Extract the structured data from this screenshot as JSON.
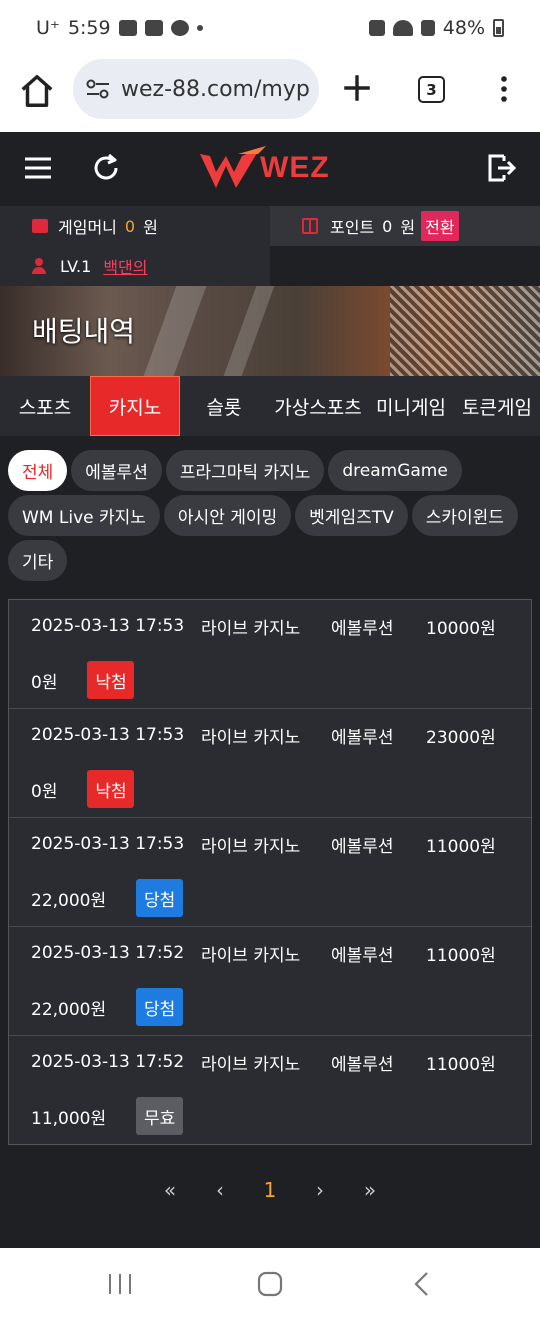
{
  "status": {
    "carrier": "U⁺",
    "time": "5:59",
    "battery": "48%"
  },
  "browser": {
    "url": "wez-88.com/myp",
    "tab_count": "3"
  },
  "site": {
    "logo_text": "WEZ",
    "money_label": "게임머니",
    "money_value": "0",
    "money_unit": "원",
    "point_label": "포인트",
    "point_value": "0",
    "point_unit": "원",
    "convert": "전환",
    "level": "LV.1",
    "nickname": "백댄의"
  },
  "banner": {
    "title": "배팅내역"
  },
  "tabs": [
    "스포츠",
    "카지노",
    "슬롯",
    "가상스포츠",
    "미니게임",
    "토큰게임"
  ],
  "chips": [
    "전체",
    "에볼루션",
    "프라그마틱 카지노",
    "dreamGame",
    "WM Live 카지노",
    "아시안 게이밍",
    "벳게임즈TV",
    "스카이윈드",
    "기타"
  ],
  "bets": [
    {
      "date": "2025-03-13 17:53",
      "type": "라이브 카지노",
      "game": "에볼루션",
      "amount": "10000원",
      "payout": "0원",
      "result": "낙첨",
      "status": "lose"
    },
    {
      "date": "2025-03-13 17:53",
      "type": "라이브 카지노",
      "game": "에볼루션",
      "amount": "23000원",
      "payout": "0원",
      "result": "낙첨",
      "status": "lose"
    },
    {
      "date": "2025-03-13 17:53",
      "type": "라이브 카지노",
      "game": "에볼루션",
      "amount": "11000원",
      "payout": "22,000원",
      "result": "당첨",
      "status": "win"
    },
    {
      "date": "2025-03-13 17:52",
      "type": "라이브 카지노",
      "game": "에볼루션",
      "amount": "11000원",
      "payout": "22,000원",
      "result": "당첨",
      "status": "win"
    },
    {
      "date": "2025-03-13 17:52",
      "type": "라이브 카지노",
      "game": "에볼루션",
      "amount": "11000원",
      "payout": "11,000원",
      "result": "무효",
      "status": "void"
    }
  ],
  "pagination": {
    "first": "«",
    "prev": "‹",
    "current": "1",
    "next": "›",
    "last": "»"
  },
  "colors": {
    "brand": "#e8292a",
    "win": "#1e7be0",
    "void": "#5c5d62",
    "page_current": "#f5a623",
    "bg": "#1f2024"
  }
}
